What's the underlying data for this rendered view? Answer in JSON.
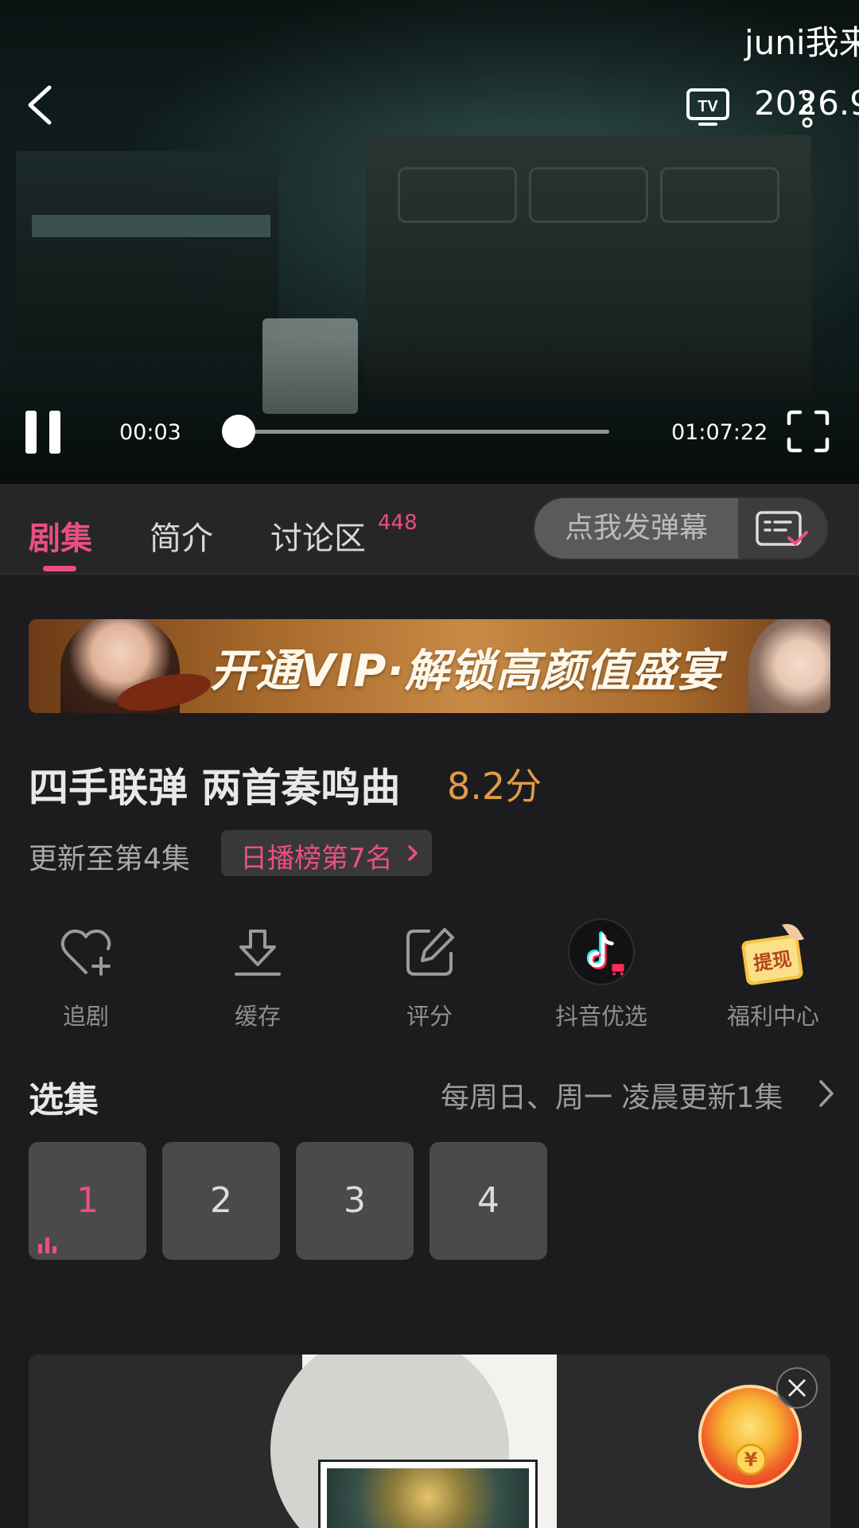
{
  "player": {
    "watermark": "juni我来",
    "date_overlay": "2026.9",
    "current_time": "00:03",
    "total_time": "01:07:22",
    "progress_fraction": 0.004
  },
  "tabs": {
    "items": [
      {
        "label": "剧集",
        "active": true
      },
      {
        "label": "简介",
        "active": false
      },
      {
        "label": "讨论区",
        "active": false
      }
    ],
    "discussion_count": "448",
    "danmu_placeholder": "点我发弹幕"
  },
  "banner": {
    "text": "开通VIP·解锁高颜值盛宴"
  },
  "show": {
    "title": "四手联弹 两首奏鸣曲",
    "score": "8.2分",
    "update_status": "更新至第4集",
    "rank_badge": "日播榜第7名"
  },
  "actions": [
    {
      "label": "追剧",
      "icon": "heart-plus-icon"
    },
    {
      "label": "缓存",
      "icon": "download-icon"
    },
    {
      "label": "评分",
      "icon": "edit-icon"
    },
    {
      "label": "抖音优选",
      "icon": "douyin-logo"
    },
    {
      "label": "福利中心",
      "icon": "withdraw-icon"
    }
  ],
  "episodes": {
    "heading": "选集",
    "schedule": "每周日、周一 凌晨更新1集",
    "items": [
      "1",
      "2",
      "3",
      "4"
    ],
    "active_index": 0
  },
  "withdraw_logo_text": "提现",
  "colors": {
    "accent": "#ec4e82",
    "score": "#e19b47",
    "background": "#1c1c1e"
  }
}
